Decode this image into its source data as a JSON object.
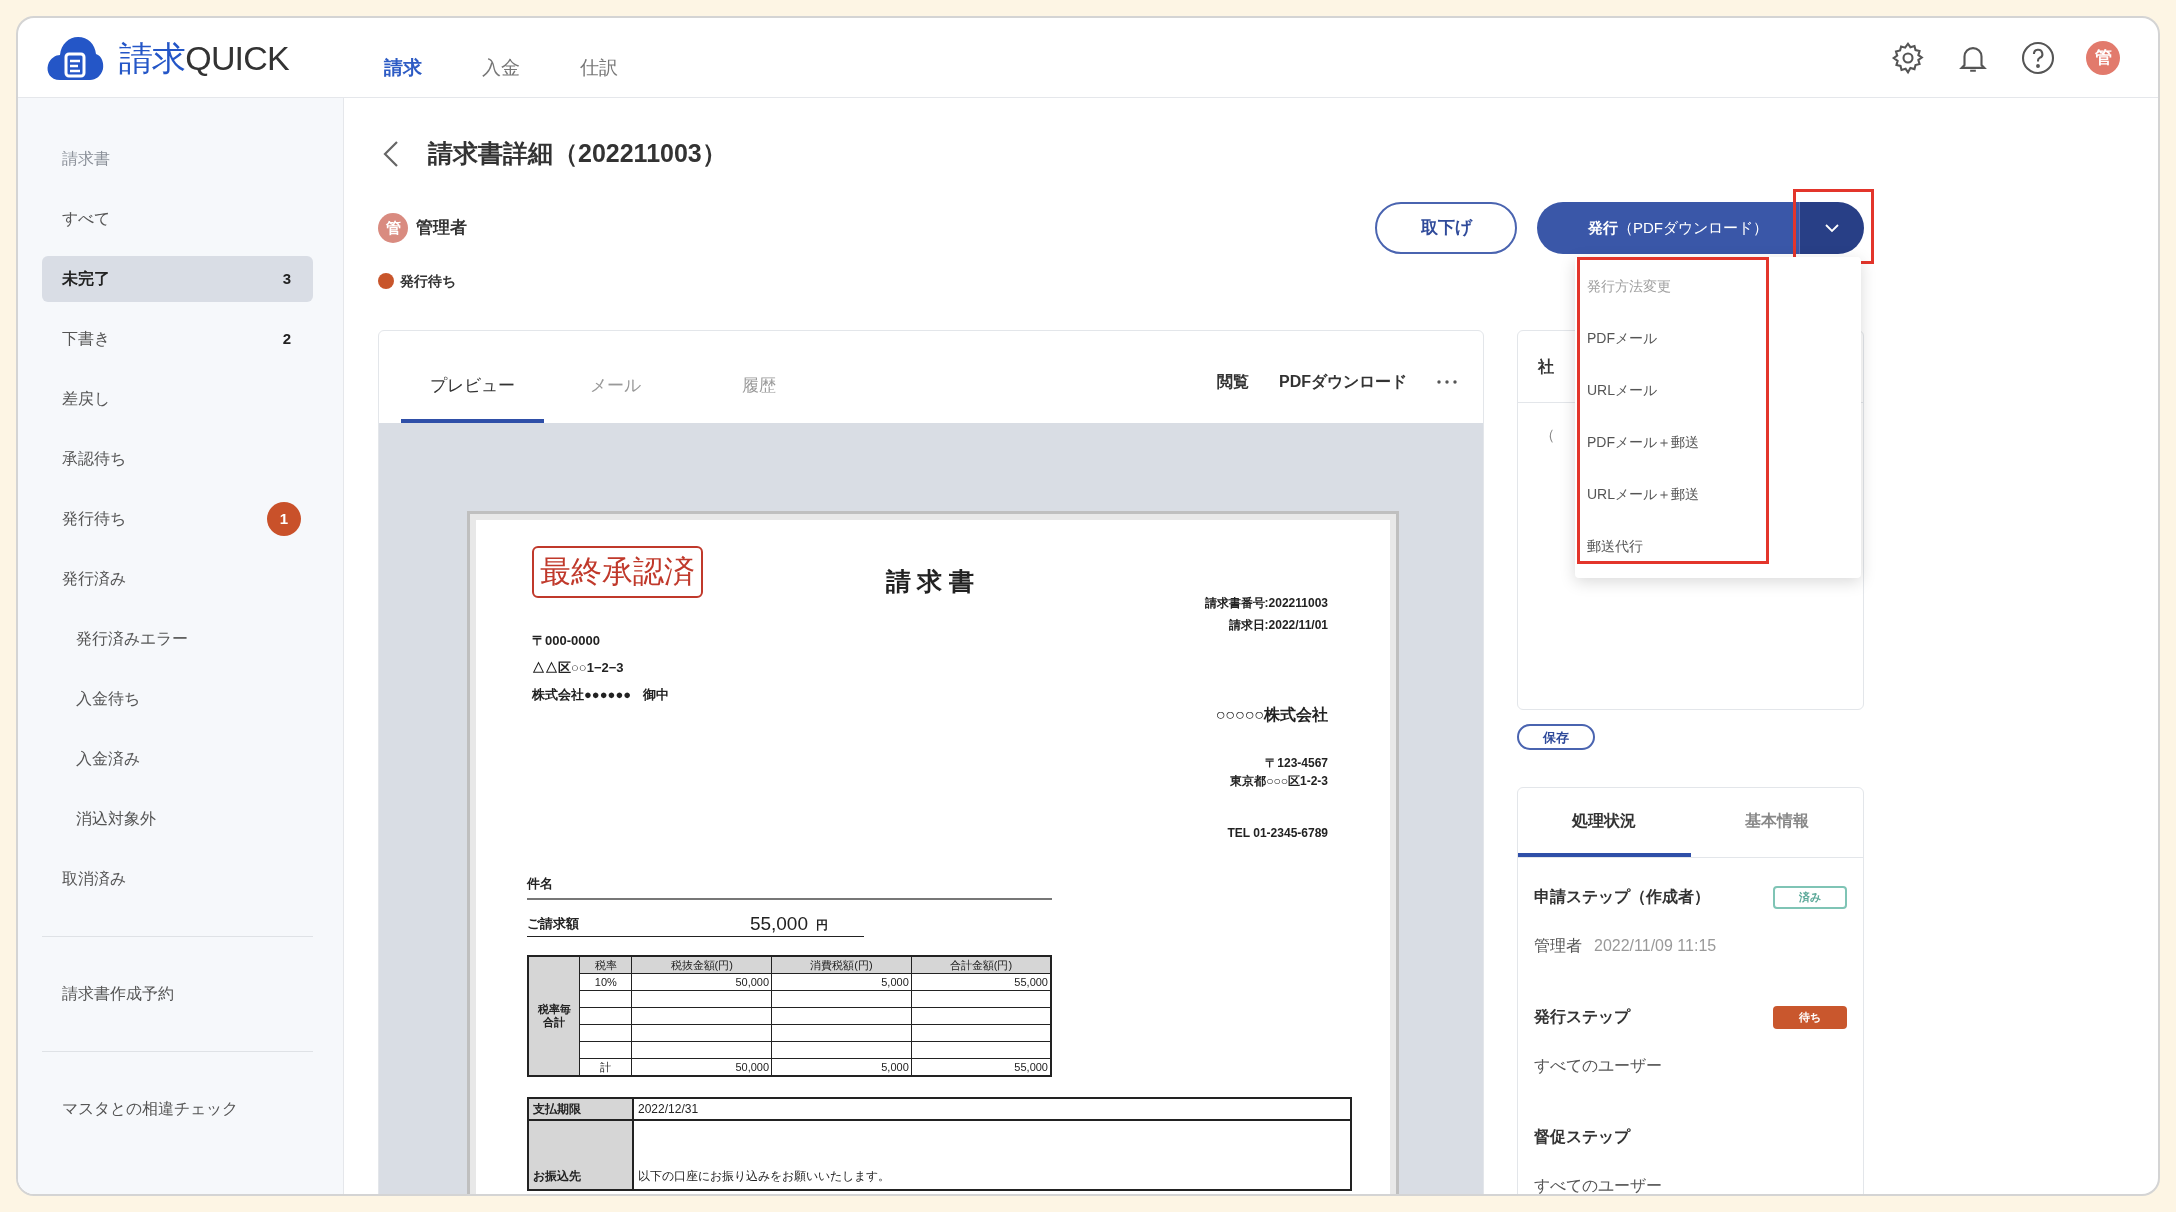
{
  "app": {
    "logo": {
      "kanji": "請求",
      "latin": "QUICK"
    },
    "nav": [
      {
        "label": "請求",
        "selected": true
      },
      {
        "label": "入金",
        "selected": false
      },
      {
        "label": "仕訳",
        "selected": false
      }
    ],
    "avatar": "管"
  },
  "sidebar": {
    "heading": "請求書",
    "items": [
      {
        "label": "すべて",
        "selected": false
      },
      {
        "label": "未完了",
        "selected": true,
        "count": "3"
      },
      {
        "label": "下書き",
        "selected": false,
        "count": "2"
      },
      {
        "label": "差戻し",
        "selected": false
      },
      {
        "label": "承認待ち",
        "selected": false
      },
      {
        "label": "発行待ち",
        "selected": false,
        "badge": "1"
      },
      {
        "label": "発行済み",
        "selected": false,
        "children": [
          {
            "label": "発行済みエラー",
            "selected": false
          },
          {
            "label": "入金待ち",
            "selected": false
          },
          {
            "label": "入金済み",
            "selected": false
          },
          {
            "label": "消込対象外",
            "selected": false
          }
        ]
      },
      {
        "label": "取消済み",
        "selected": false
      }
    ],
    "extra_sections": [
      "請求書作成予約",
      "マスタとの相違チェック"
    ]
  },
  "page": {
    "title": "請求書詳細（202211003）",
    "owner": {
      "avatar": "管",
      "name": "管理者"
    },
    "status": "発行待ち",
    "withdraw_button": "取下げ",
    "issue_button": "**発行**（PDFダウンロード）",
    "issue_menu": {
      "heading": "発行方法変更",
      "items": [
        "PDFメール",
        "URLメール",
        "PDFメール＋郵送",
        "URLメール＋郵送",
        "郵送代行"
      ]
    }
  },
  "preview": {
    "tabs": [
      {
        "label": "プレビュー",
        "selected": true
      },
      {
        "label": "メール",
        "selected": false
      },
      {
        "label": "履歴",
        "selected": false
      }
    ],
    "actions": [
      "閲覧",
      "PDFダウンロード"
    ],
    "document": {
      "stamp": "最終承認済",
      "title": "請 求 書",
      "meta": [
        "請求書番号:202211003",
        "請求日:2022/11/01"
      ],
      "recipient_lines": [
        "〒000-0000",
        "△△区○○1−2−3"
      ],
      "recipient_name": "株式会社●●●●●●",
      "honorific": "御中",
      "issuer": "○○○○○株式会社",
      "issuer_address": [
        "〒123-4567",
        "東京都○○○区1-2-3"
      ],
      "tel": "TEL 01-2345-6789",
      "subject_label": "件名",
      "amount_label": "ご請求額",
      "amount": "55,000",
      "currency": "円",
      "tax_table": {
        "side_label": "税率毎合計",
        "columns": [
          "税率",
          "税抜金額(円)",
          "消費税額(円)",
          "合計金額(円)"
        ],
        "rows": [
          [
            "10%",
            "50,000",
            "5,000",
            "55,000"
          ]
        ],
        "total": [
          "計",
          "50,000",
          "5,000",
          "55,000"
        ]
      },
      "payment": [
        {
          "label": "支払期限",
          "value": "2022/12/31"
        },
        {
          "label": "お振込先",
          "value": "以下の口座にお振り込みをお願いいたします。"
        }
      ]
    }
  },
  "memo": {
    "title": "社",
    "body": "（",
    "save_button": "保存"
  },
  "process": {
    "tabs": [
      {
        "label": "処理状況",
        "selected": true
      },
      {
        "label": "基本情報",
        "selected": false
      }
    ],
    "steps": [
      {
        "title": "申請ステップ（作成者）",
        "badge": "済み",
        "kind": "done",
        "user": "管理者",
        "time": "2022/11/09 11:15"
      },
      {
        "title": "発行ステップ",
        "badge": "待ち",
        "kind": "waiting",
        "user": "すべてのユーザー"
      },
      {
        "title": "督促ステップ",
        "user": "すべてのユーザー"
      }
    ]
  }
}
